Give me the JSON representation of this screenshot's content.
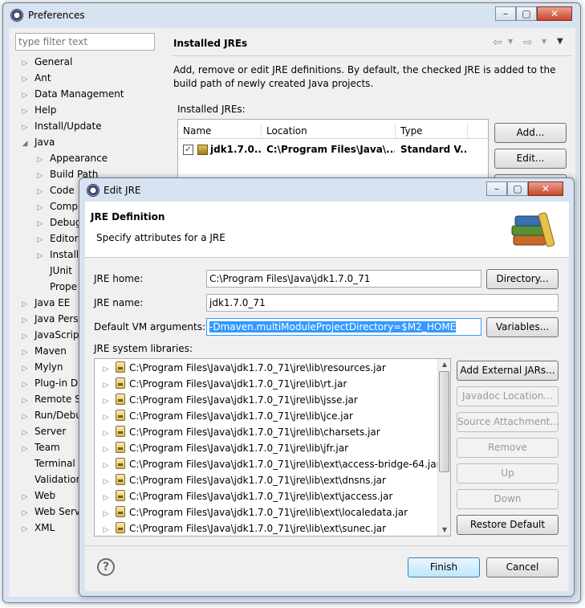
{
  "preferences": {
    "title": "Preferences",
    "filter_placeholder": "type filter text",
    "page_title": "Installed JREs",
    "description_line1": "Add, remove or edit JRE definitions. By default, the checked JRE is added to the",
    "description_line2": "build path of newly created Java projects.",
    "installed_label": "Installed JREs:",
    "columns": {
      "name": "Name",
      "location": "Location",
      "type": "Type"
    },
    "jre_row": {
      "name": "jdk1.7.0...",
      "location": "C:\\Program Files\\Java\\...",
      "type": "Standard V..."
    },
    "buttons": {
      "add": "Add...",
      "edit": "Edit..."
    },
    "tree": [
      {
        "label": "General",
        "level": 0,
        "arrow": "▷"
      },
      {
        "label": "Ant",
        "level": 0,
        "arrow": "▷"
      },
      {
        "label": "Data Management",
        "level": 0,
        "arrow": "▷"
      },
      {
        "label": "Help",
        "level": 0,
        "arrow": "▷"
      },
      {
        "label": "Install/Update",
        "level": 0,
        "arrow": "▷"
      },
      {
        "label": "Java",
        "level": 0,
        "arrow": "◢"
      },
      {
        "label": "Appearance",
        "level": 1,
        "arrow": "▷"
      },
      {
        "label": "Build Path",
        "level": 1,
        "arrow": "▷"
      },
      {
        "label": "Code",
        "level": 1,
        "arrow": "▷"
      },
      {
        "label": "Comp",
        "level": 1,
        "arrow": "▷"
      },
      {
        "label": "Debug",
        "level": 1,
        "arrow": "▷"
      },
      {
        "label": "Editor",
        "level": 1,
        "arrow": "▷"
      },
      {
        "label": "Installe",
        "level": 1,
        "arrow": "▷"
      },
      {
        "label": "JUnit",
        "level": 1,
        "arrow": ""
      },
      {
        "label": "Prope",
        "level": 1,
        "arrow": ""
      },
      {
        "label": "Java EE",
        "level": 0,
        "arrow": "▷"
      },
      {
        "label": "Java Pers",
        "level": 0,
        "arrow": "▷"
      },
      {
        "label": "JavaScrip",
        "level": 0,
        "arrow": "▷"
      },
      {
        "label": "Maven",
        "level": 0,
        "arrow": "▷"
      },
      {
        "label": "Mylyn",
        "level": 0,
        "arrow": "▷"
      },
      {
        "label": "Plug-in D",
        "level": 0,
        "arrow": "▷"
      },
      {
        "label": "Remote S",
        "level": 0,
        "arrow": "▷"
      },
      {
        "label": "Run/Debu",
        "level": 0,
        "arrow": "▷"
      },
      {
        "label": "Server",
        "level": 0,
        "arrow": "▷"
      },
      {
        "label": "Team",
        "level": 0,
        "arrow": "▷"
      },
      {
        "label": "Terminal",
        "level": 0,
        "arrow": ""
      },
      {
        "label": "Validation",
        "level": 0,
        "arrow": ""
      },
      {
        "label": "Web",
        "level": 0,
        "arrow": "▷"
      },
      {
        "label": "Web Serv",
        "level": 0,
        "arrow": "▷"
      },
      {
        "label": "XML",
        "level": 0,
        "arrow": "▷"
      }
    ]
  },
  "edit_jre": {
    "title": "Edit JRE",
    "header_title": "JRE Definition",
    "header_subtitle": "Specify attributes for a JRE",
    "jre_home_label": "JRE home:",
    "jre_home_value": "C:\\Program Files\\Java\\jdk1.7.0_71",
    "jre_name_label": "JRE name:",
    "jre_name_value": "jdk1.7.0_71",
    "vm_args_label": "Default VM arguments:",
    "vm_args_value": "-Dmaven.multiModuleProjectDirectory=$M2_HOME",
    "libraries_label": "JRE system libraries:",
    "libraries": [
      "C:\\Program Files\\Java\\jdk1.7.0_71\\jre\\lib\\resources.jar",
      "C:\\Program Files\\Java\\jdk1.7.0_71\\jre\\lib\\rt.jar",
      "C:\\Program Files\\Java\\jdk1.7.0_71\\jre\\lib\\jsse.jar",
      "C:\\Program Files\\Java\\jdk1.7.0_71\\jre\\lib\\jce.jar",
      "C:\\Program Files\\Java\\jdk1.7.0_71\\jre\\lib\\charsets.jar",
      "C:\\Program Files\\Java\\jdk1.7.0_71\\jre\\lib\\jfr.jar",
      "C:\\Program Files\\Java\\jdk1.7.0_71\\jre\\lib\\ext\\access-bridge-64.jar",
      "C:\\Program Files\\Java\\jdk1.7.0_71\\jre\\lib\\ext\\dnsns.jar",
      "C:\\Program Files\\Java\\jdk1.7.0_71\\jre\\lib\\ext\\jaccess.jar",
      "C:\\Program Files\\Java\\jdk1.7.0_71\\jre\\lib\\ext\\localedata.jar",
      "C:\\Program Files\\Java\\jdk1.7.0_71\\jre\\lib\\ext\\sunec.jar"
    ],
    "buttons": {
      "directory": "Directory...",
      "variables": "Variables...",
      "add_external": "Add External JARs...",
      "javadoc": "Javadoc Location...",
      "source": "Source Attachment...",
      "remove": "Remove",
      "up": "Up",
      "down": "Down",
      "restore": "Restore Default",
      "finish": "Finish",
      "cancel": "Cancel"
    }
  }
}
